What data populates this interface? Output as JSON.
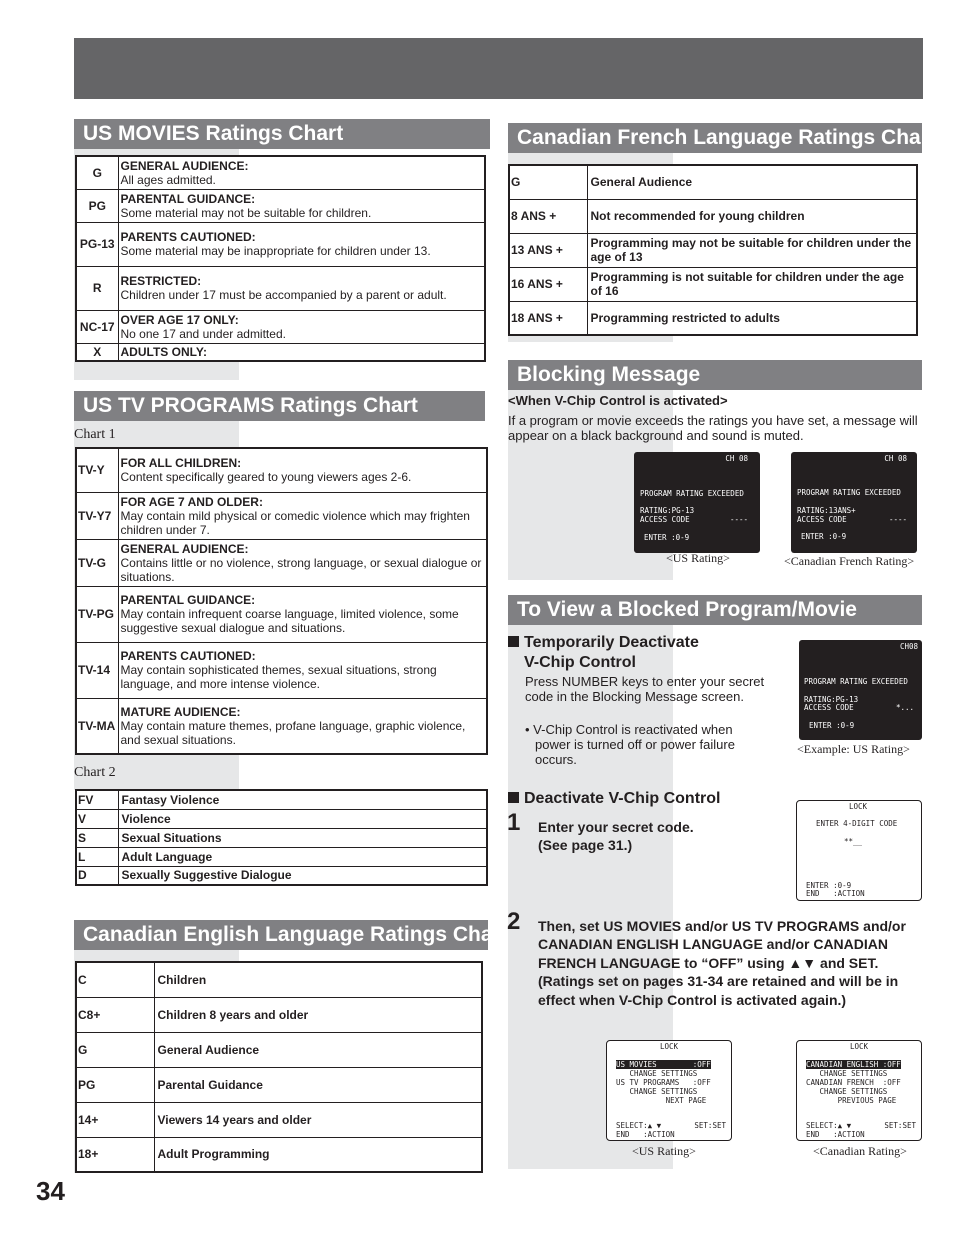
{
  "page_number": "34",
  "us_movies": {
    "title": "US MOVIES Ratings Chart",
    "rows": [
      {
        "code": "G",
        "heading": "GENERAL AUDIENCE:",
        "desc": "All ages admitted."
      },
      {
        "code": "PG",
        "heading": "PARENTAL GUIDANCE:",
        "desc": "Some material may not be suitable for children."
      },
      {
        "code": "PG-13",
        "heading": "PARENTS CAUTIONED:",
        "desc": "Some material may be inappropriate for children under 13."
      },
      {
        "code": "R",
        "heading": "RESTRICTED:",
        "desc": "Children under 17 must be accompanied by a parent or adult."
      },
      {
        "code": "NC-17",
        "heading": "OVER AGE 17 ONLY:",
        "desc": "No one 17 and under admitted."
      },
      {
        "code": "X",
        "heading": "ADULTS ONLY:",
        "desc": ""
      }
    ]
  },
  "us_tv": {
    "title": "US TV PROGRAMS Ratings Chart",
    "chart1_label": "Chart 1",
    "chart1": [
      {
        "code": "TV-Y",
        "heading": "FOR ALL CHILDREN:",
        "desc": "Content specifically geared to young viewers ages 2-6."
      },
      {
        "code": "TV-Y7",
        "heading": "FOR AGE 7 AND OLDER:",
        "desc": "May contain mild physical or comedic violence which may frighten children under 7."
      },
      {
        "code": "TV-G",
        "heading": "GENERAL AUDIENCE:",
        "desc": "Contains little or no violence, strong language, or sexual dialogue or situations."
      },
      {
        "code": "TV-PG",
        "heading": "PARENTAL GUIDANCE:",
        "desc": "May contain infrequent coarse language, limited violence, some suggestive sexual dialogue and situations."
      },
      {
        "code": "TV-14",
        "heading": "PARENTS CAUTIONED:",
        "desc": "May contain sophisticated themes, sexual situations, strong language, and more intense violence."
      },
      {
        "code": "TV-MA",
        "heading": "MATURE AUDIENCE:",
        "desc": "May contain mature themes, profane language, graphic violence, and sexual situations."
      }
    ],
    "chart2_label": "Chart 2",
    "chart2": [
      {
        "code": "FV",
        "desc": "Fantasy Violence"
      },
      {
        "code": "V",
        "desc": "Violence"
      },
      {
        "code": "S",
        "desc": "Sexual Situations"
      },
      {
        "code": "L",
        "desc": "Adult Language"
      },
      {
        "code": "D",
        "desc": "Sexually Suggestive Dialogue"
      }
    ]
  },
  "canadian_english": {
    "title": "Canadian English Language Ratings Chart",
    "rows": [
      {
        "code": "C",
        "desc": "Children"
      },
      {
        "code": "C8+",
        "desc": "Children 8 years and older"
      },
      {
        "code": "G",
        "desc": "General Audience"
      },
      {
        "code": "PG",
        "desc": "Parental Guidance"
      },
      {
        "code": "14+",
        "desc": "Viewers 14 years and older"
      },
      {
        "code": "18+",
        "desc": "Adult Programming"
      }
    ]
  },
  "canadian_french": {
    "title": "Canadian French Language Ratings Chart",
    "rows": [
      {
        "code": "G",
        "desc": "General Audience"
      },
      {
        "code": "8 ANS +",
        "desc": "Not recommended for young children"
      },
      {
        "code": "13 ANS +",
        "desc": "Programming may not be suitable for children under the age of 13"
      },
      {
        "code": "16 ANS +",
        "desc": "Programming is not suitable for children under the age of 16"
      },
      {
        "code": "18 ANS +",
        "desc": "Programming restricted to adults"
      }
    ]
  },
  "blocking": {
    "title": "Blocking Message",
    "subtitle": "<When V-Chip Control is activated>",
    "body": "If a program or movie exceeds the ratings you have set, a message will appear on a black background and sound is muted.",
    "screens": [
      {
        "channel": "CH 08",
        "message": "PROGRAM RATING EXCEEDED",
        "rating": "RATING:PG-13",
        "access": "ACCESS CODE",
        "code": "----",
        "enter": "ENTER :0-9",
        "caption": "<US Rating>"
      },
      {
        "channel": "CH 08",
        "message": "PROGRAM RATING EXCEEDED",
        "rating": "RATING:13ANS+",
        "access": "ACCESS CODE",
        "code": "----",
        "enter": "ENTER :0-9",
        "caption": "<Canadian French Rating>"
      }
    ]
  },
  "view_blocked": {
    "title": "To View a Blocked Program/Movie",
    "temp_heading_1": "Temporarily Deactivate",
    "temp_heading_2": "V-Chip Control",
    "temp_body": "Press NUMBER keys to enter your secret code in the Blocking Message screen.",
    "temp_bullet": "V-Chip Control is reactivated when power is turned off or power failure occurs.",
    "example_screen": {
      "channel": "CH08",
      "message": "PROGRAM RATING EXCEEDED",
      "rating": "RATING:PG-13",
      "access": "ACCESS CODE",
      "code": "*...",
      "enter": "ENTER :0-9",
      "caption": "<Example: US Rating>"
    },
    "deactivate_heading": "Deactivate V-Chip Control",
    "step1_num": "1",
    "step1_line1": "Enter your secret code.",
    "step1_line2": "(See page 31.)",
    "lock_screen": {
      "title": "LOCK",
      "prompt": "ENTER 4-DIGIT CODE",
      "code": "**__",
      "enter": "ENTER :0-9",
      "end": "END   :ACTION"
    },
    "step2_num": "2",
    "step2_text": "Then, set US MOVIES and/or US TV PROGRAMS and/or CANADIAN ENGLISH LANGUAGE and/or CANADIAN FRENCH LANGUAGE to “OFF” using ▲▼ and SET. (Ratings set on pages 31-34 are retained and will be in effect when V-Chip Control is activated again.)",
    "menus": [
      {
        "title": "LOCK",
        "line1": "US MOVIES        :OFF",
        "line2": "   CHANGE SETTINGS",
        "line3": "US TV PROGRAMS   :OFF",
        "line4": "   CHANGE SETTINGS",
        "line5": "           NEXT PAGE",
        "select": "SELECT:▲ ▼",
        "set": "SET:SET",
        "end": "END   :ACTION",
        "caption": "<US Rating>"
      },
      {
        "title": "LOCK",
        "line1": "CANADIAN ENGLISH :OFF",
        "line2": "   CHANGE SETTINGS",
        "line3": "CANADIAN FRENCH  :OFF",
        "line4": "   CHANGE SETTINGS",
        "line5": "       PREVIOUS PAGE",
        "select": "SELECT:▲ ▼",
        "set": "SET:SET",
        "end": "END   :ACTION",
        "caption": "<Canadian Rating>"
      }
    ]
  }
}
